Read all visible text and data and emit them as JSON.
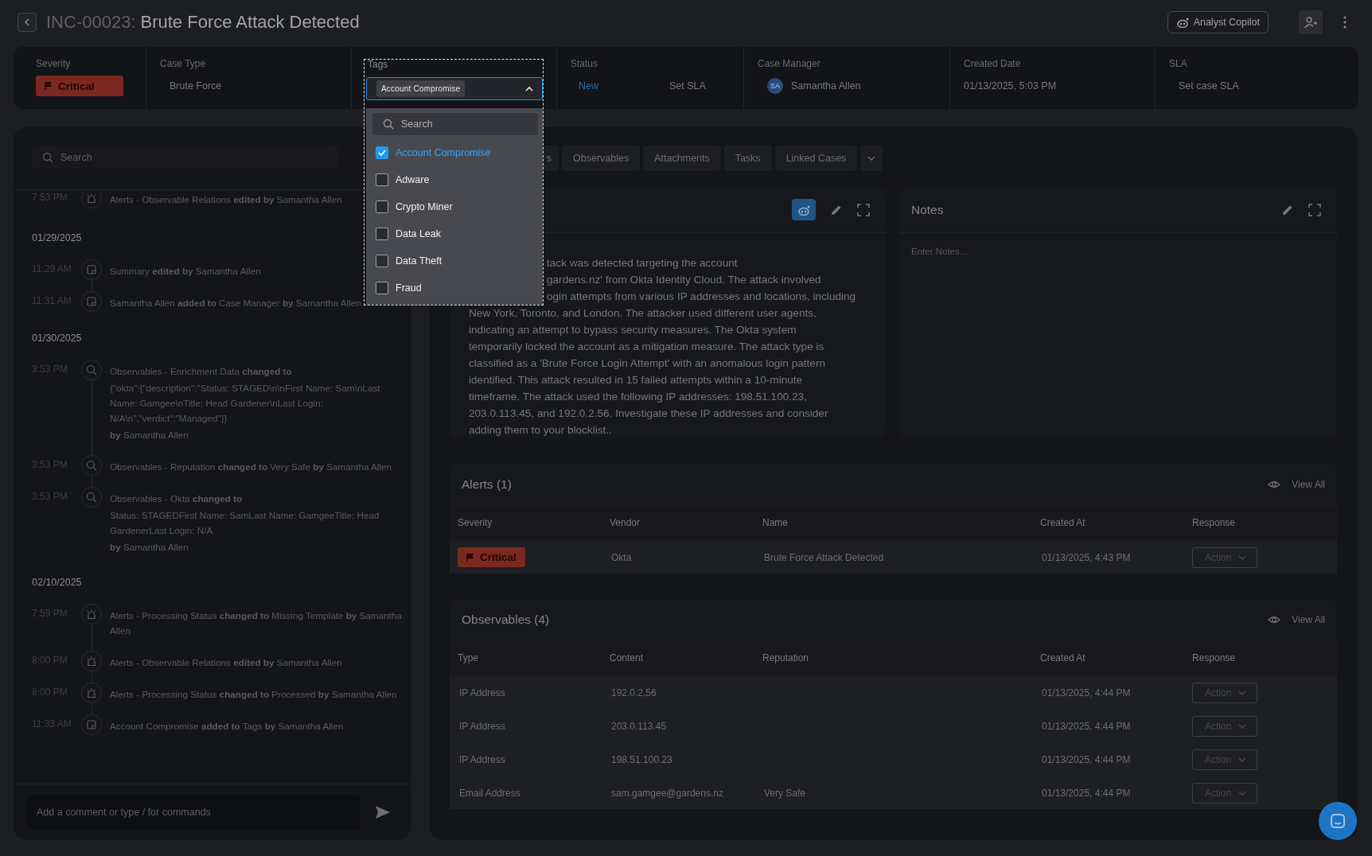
{
  "header": {
    "case_id": "INC-00023:",
    "title": "Brute Force Attack Detected",
    "copilot_button": "Analyst Copilot"
  },
  "fields": {
    "severity": {
      "label": "Severity",
      "value": "Critical"
    },
    "case_type": {
      "label": "Case Type",
      "value": "Brute Force"
    },
    "tags": {
      "label": "Tags",
      "expanded": true,
      "chips": [
        "Account Compromise"
      ],
      "search_placeholder": "Search",
      "options": [
        {
          "label": "Account Compromise",
          "checked": true
        },
        {
          "label": "Adware",
          "checked": false
        },
        {
          "label": "Crypto Miner",
          "checked": false
        },
        {
          "label": "Data Leak",
          "checked": false
        },
        {
          "label": "Data Theft",
          "checked": false
        },
        {
          "label": "Fraud",
          "checked": false
        }
      ]
    },
    "status": {
      "label": "Status",
      "value": "New",
      "sla": "Set SLA"
    },
    "case_manager": {
      "label": "Case Manager",
      "initials": "SA",
      "name": "Samantha Allen"
    },
    "created_date": {
      "label": "Created Date",
      "value": "01/13/2025, 5:03 PM"
    },
    "sla": {
      "label": "SLA",
      "value": "Set case SLA"
    }
  },
  "activity": {
    "search_placeholder": "Search",
    "groups": [
      {
        "entries": [
          {
            "time": "7:53 PM",
            "kind": "siren",
            "lines": [
              "Alerts - Observable Relations **edited by** Samantha Allen"
            ]
          }
        ]
      },
      {
        "date": "01/29/2025",
        "entries": [
          {
            "time": "11:29 AM",
            "kind": "note",
            "lines": [
              "Summary **edited by** Samantha Allen"
            ]
          },
          {
            "time": "11:31 AM",
            "kind": "note",
            "lines": [
              "Samantha Allen **added to** Case Manager **by** Samantha Allen"
            ]
          }
        ]
      },
      {
        "date": "01/30/2025",
        "entries": [
          {
            "time": "3:53 PM",
            "kind": "search",
            "lines": [
              "Observables - Enrichment Data **changed to**",
              "{\"okta\":{\"description\":\"Status: STAGED\\n\\nFirst Name: Sam\\nLast Name: Gamgee\\nTitle: Head Gardener\\nLast Login: N/A\\n\",\"verdict\":\"Managed\"}}",
              "**by** Samantha Allen"
            ]
          },
          {
            "time": "3:53 PM",
            "kind": "search",
            "lines": [
              "Observables - Reputation **changed to** Very Safe **by** Samantha Allen"
            ]
          },
          {
            "time": "3:53 PM",
            "kind": "search",
            "lines": [
              "Observables - Okta **changed to**",
              "Status: STAGEDFirst Name: SamLast Name: GamgeeTitle: Head GardenerLast Login: N/A",
              "**by** Samantha Allen"
            ]
          }
        ]
      },
      {
        "date": "02/10/2025",
        "entries": [
          {
            "time": "7:59 PM",
            "kind": "siren",
            "lines": [
              "Alerts - Processing Status **changed to** Missing Template **by** Samantha Allen"
            ]
          },
          {
            "time": "8:00 PM",
            "kind": "siren",
            "lines": [
              "Alerts - Observable Relations **edited by** Samantha Allen"
            ]
          },
          {
            "time": "8:00 PM",
            "kind": "siren",
            "lines": [
              "Alerts - Processing Status **changed to** Processed **by** Samantha Allen"
            ]
          },
          {
            "time": "11:33 AM",
            "kind": "note",
            "lines": [
              "Account Compromise **added to** Tags **by** Samantha Allen"
            ]
          }
        ]
      }
    ],
    "comment_placeholder": "Add a comment or type / for commands"
  },
  "tabs": [
    {
      "label": "s",
      "selected": false
    },
    {
      "label": "Observables",
      "selected": false
    },
    {
      "label": "Attachments",
      "selected": false
    },
    {
      "label": "Tasks",
      "selected": false
    },
    {
      "label": "Linked Cases",
      "selected": false
    }
  ],
  "summary": {
    "covered_lines": [
      "tack was detected targeting the account",
      "gardens.nz' from Okta Identity Cloud. The attack involved",
      "ogin attempts from various IP addresses and locations, including"
    ],
    "lines": [
      "New York, Toronto, and London. The attacker used different user agents,",
      "indicating an attempt to bypass security measures.  The Okta system",
      "temporarily locked the account as a mitigation measure. The attack type is",
      "classified as a 'Brute Force Login Attempt' with an anomalous login pattern",
      "identified. This attack resulted in 15 failed attempts within a 10-minute",
      "timeframe.  The attack used the following IP addresses: 198.51.100.23,",
      "203.0.113.45, and 192.0.2.56.  Investigate these IP addresses and consider",
      "adding them to your blocklist.."
    ]
  },
  "notes": {
    "title": "Notes",
    "placeholder": "Enter Notes..."
  },
  "alerts": {
    "title": "Alerts (1)",
    "view_all": "View All",
    "columns": [
      "Severity",
      "Vendor",
      "Name",
      "Created At",
      "Response"
    ],
    "rows": [
      {
        "severity": "Critical",
        "vendor": "Okta",
        "name": "Brute Force Attack Detected",
        "created_at": "01/13/2025, 4:43 PM",
        "action": "Action"
      }
    ]
  },
  "observables": {
    "title": "Observables (4)",
    "view_all": "View All",
    "columns": [
      "Type",
      "Content",
      "Reputation",
      "Created At",
      "Response"
    ],
    "rows": [
      {
        "type": "IP Address",
        "content": "192.0.2.56",
        "created_at": "01/13/2025, 4:44 PM",
        "action": "Action"
      },
      {
        "type": "IP Address",
        "content": "203.0.113.45",
        "created_at": "01/13/2025, 4:44 PM",
        "action": "Action"
      },
      {
        "type": "IP Address",
        "content": "198.51.100.23",
        "created_at": "01/13/2025, 4:44 PM",
        "action": "Action"
      },
      {
        "type": "Email Address",
        "content": "sam.gamgee@gardens.nz",
        "reputation": "Very Safe",
        "created_at": "01/13/2025, 4:44 PM",
        "action": "Action"
      }
    ]
  }
}
